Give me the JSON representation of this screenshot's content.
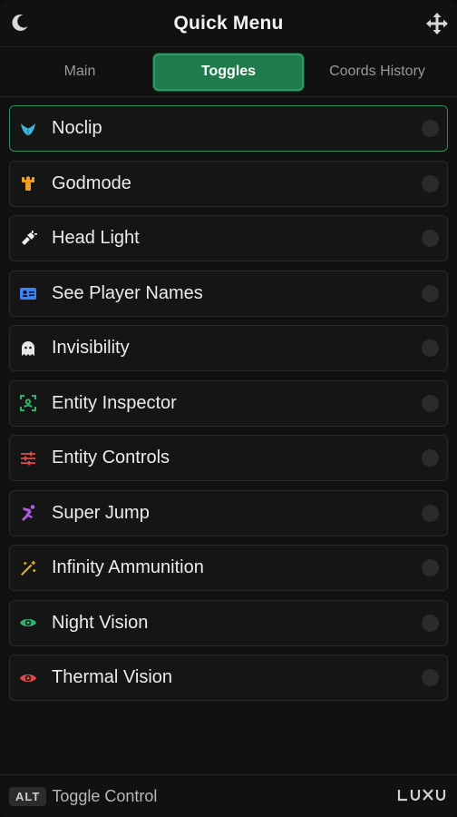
{
  "header": {
    "title": "Quick Menu",
    "left_icon": "moon-icon",
    "right_icon": "move-arrows-icon"
  },
  "tabs": [
    {
      "label": "Main",
      "active": false
    },
    {
      "label": "Toggles",
      "active": true
    },
    {
      "label": "Coords History",
      "active": false
    }
  ],
  "items": [
    {
      "label": "Noclip",
      "icon": "wings-icon",
      "color": "#3bb7d9",
      "selected": true
    },
    {
      "label": "Godmode",
      "icon": "strength-icon",
      "color": "#f0a020",
      "selected": false
    },
    {
      "label": "Head Light",
      "icon": "flashlight-icon",
      "color": "#f2f2f2",
      "selected": false
    },
    {
      "label": "See Player Names",
      "icon": "id-card-icon",
      "color": "#3b82f6",
      "selected": false
    },
    {
      "label": "Invisibility",
      "icon": "ghost-icon",
      "color": "#e6e6e6",
      "selected": false
    },
    {
      "label": "Entity Inspector",
      "icon": "scan-icon",
      "color": "#2fb36a",
      "selected": false
    },
    {
      "label": "Entity Controls",
      "icon": "sliders-icon",
      "color": "#e24848",
      "selected": false
    },
    {
      "label": "Super Jump",
      "icon": "person-jump-icon",
      "color": "#b35be8",
      "selected": false
    },
    {
      "label": "Infinity Ammunition",
      "icon": "wand-icon",
      "color": "#e0b020",
      "selected": false
    },
    {
      "label": "Night Vision",
      "icon": "eye-icon",
      "color": "#2fb36a",
      "selected": false
    },
    {
      "label": "Thermal Vision",
      "icon": "eye-icon",
      "color": "#e24848",
      "selected": false
    }
  ],
  "footer": {
    "key": "ALT",
    "hint": "Toggle Control",
    "brand": "LUXU"
  }
}
